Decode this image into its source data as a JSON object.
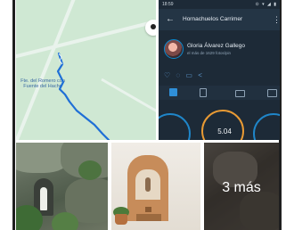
{
  "map": {
    "place_label": "Fte. del Romero con Fuente del Hacho",
    "compass_icon": "compass-icon",
    "route_color": "#1f6fd6"
  },
  "app_screenshot": {
    "status_time": "18:59",
    "status_icons": "⊙ ▾ ◢ ▮",
    "title": "Hornachuelos Carrimer",
    "back_icon": "arrow-back-icon",
    "menu_icon": "overflow-menu-icon",
    "user_name": "Gloria Álvarez Gallego",
    "user_subtitle": "el más de 1629 fotos/pin",
    "action_icons": [
      "heart-icon",
      "comment-icon",
      "bookmark-icon",
      "share-icon"
    ],
    "tabs": [
      "map-tab-icon",
      "document-tab-icon",
      "chat-tab-icon",
      "photo-tab-icon"
    ],
    "stat_value": "5.04",
    "accent_blue": "#1f86c9",
    "accent_orange": "#e89a34"
  },
  "photos": {
    "more_label": "3 más"
  }
}
